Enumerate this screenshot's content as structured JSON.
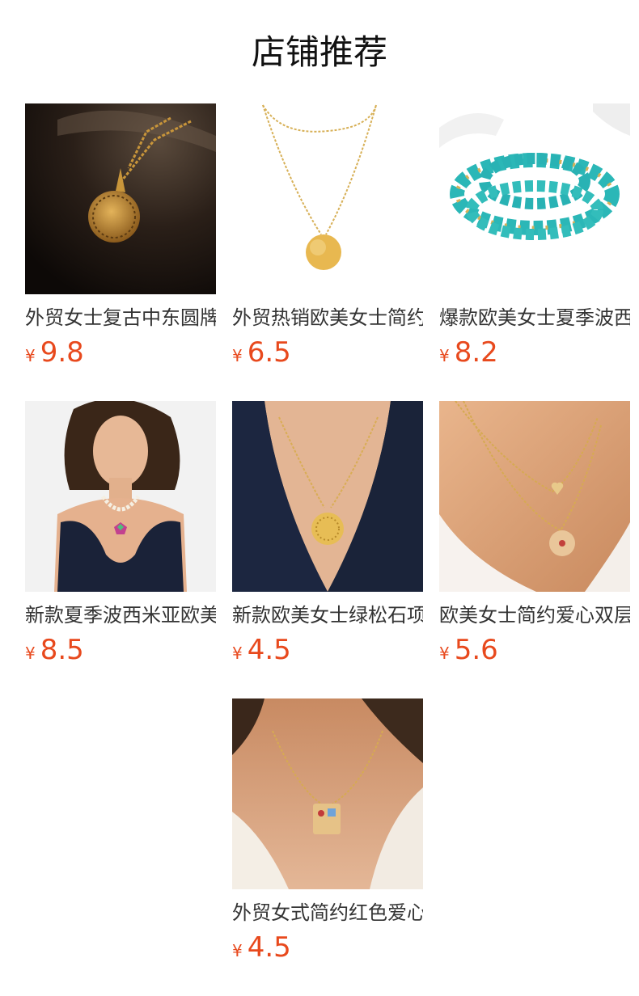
{
  "header": {
    "title": "店铺推荐"
  },
  "accent": {
    "price_color": "#e8491d"
  },
  "products": [
    {
      "name": "外贸女士复古中东圆牌",
      "currency": "¥",
      "price": "9.8",
      "image_icon": "necklace-coin-pendant-dark"
    },
    {
      "name": "外贸热销欧美女士简约",
      "currency": "¥",
      "price": "6.5",
      "image_icon": "necklace-layered-disc"
    },
    {
      "name": "爆款欧美女士夏季波西米",
      "currency": "¥",
      "price": "8.2",
      "image_icon": "necklace-turquoise-beads"
    },
    {
      "name": "新款夏季波西米亚欧美",
      "currency": "¥",
      "price": "8.5",
      "image_icon": "model-pearl-necklace"
    },
    {
      "name": "新款欧美女士绿松石项",
      "currency": "¥",
      "price": "4.5",
      "image_icon": "model-disc-necklace"
    },
    {
      "name": "欧美女士简约爱心双层",
      "currency": "¥",
      "price": "5.6",
      "image_icon": "model-heart-layered-necklace"
    },
    {
      "name": "外贸女式简约红色爱心",
      "currency": "¥",
      "price": "4.5",
      "image_icon": "model-letter-pendant"
    }
  ]
}
